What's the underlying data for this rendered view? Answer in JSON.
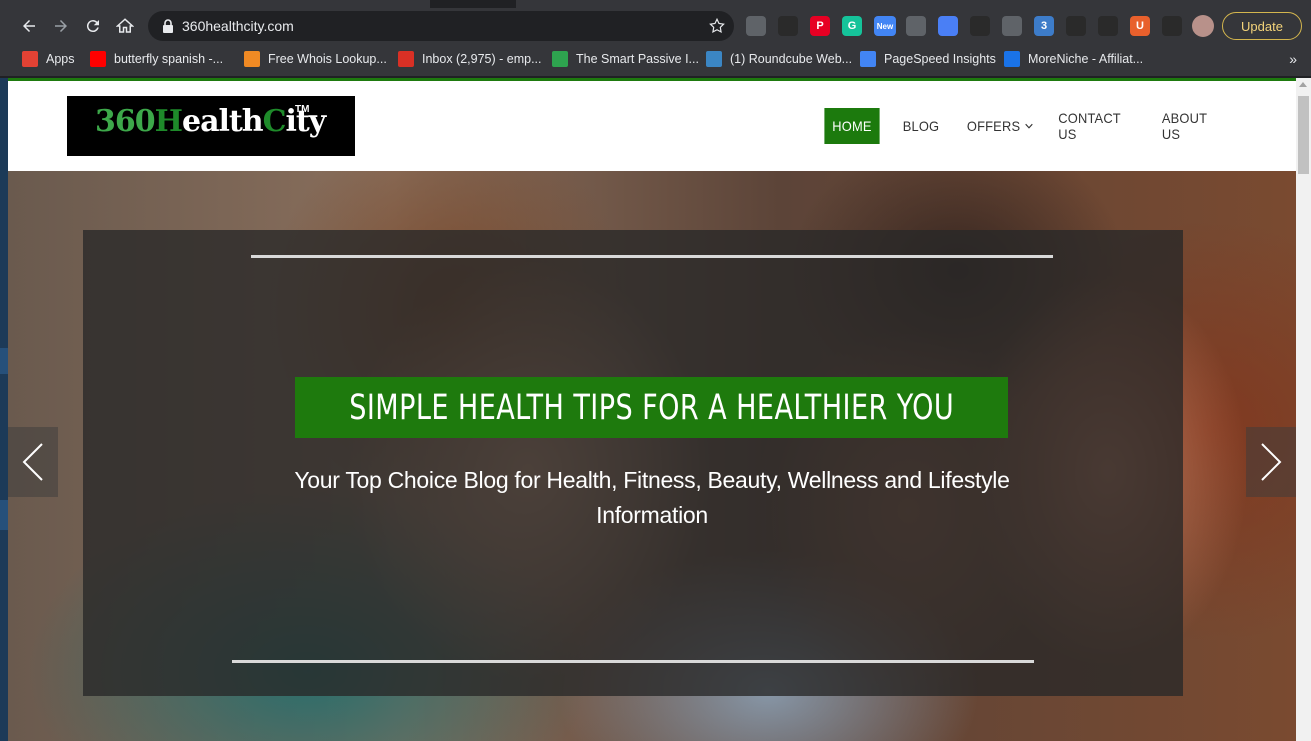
{
  "browser": {
    "url": "360healthcity.com",
    "update_label": "Update",
    "extensions": [
      {
        "name": "download-icon",
        "label": "",
        "color": "#5f6368"
      },
      {
        "name": "pencil-ext-icon",
        "label": "",
        "color": "#2a2a2a"
      },
      {
        "name": "pinterest-icon",
        "label": "P",
        "color": "#e60023"
      },
      {
        "name": "grammarly-icon",
        "label": "G",
        "color": "#15c39a"
      },
      {
        "name": "new-ext-icon",
        "label": "New",
        "color": "#4285f4"
      },
      {
        "name": "half-circle-ext-icon",
        "label": "",
        "color": "#5f6368"
      },
      {
        "name": "checkbox-ext-icon",
        "label": "",
        "color": "#4a7ff5"
      },
      {
        "name": "checkmark-ext-icon",
        "label": "",
        "color": "#2a2a2a"
      },
      {
        "name": "diamond-ext-icon",
        "label": "",
        "color": "#5f6368"
      },
      {
        "name": "code-ext-icon",
        "label": "3",
        "color": "#3d7cc9"
      },
      {
        "name": "react-ext-icon",
        "label": "",
        "color": "#2a2a2a"
      },
      {
        "name": "target-ext-icon",
        "label": "",
        "color": "#2a2a2a"
      },
      {
        "name": "ublock-icon",
        "label": "U",
        "color": "#e8602c"
      },
      {
        "name": "puzzle-icon",
        "label": "",
        "color": "#2a2a2a"
      }
    ]
  },
  "bookmarks": [
    {
      "name": "bookmark-apps",
      "label": "Apps",
      "color": "#e34234"
    },
    {
      "name": "bookmark-butterfly-spanish",
      "label": "butterfly spanish -...",
      "color": "#ff0000"
    },
    {
      "name": "bookmark-whois",
      "label": "Free Whois Lookup...",
      "color": "#f08a24"
    },
    {
      "name": "bookmark-inbox",
      "label": "Inbox (2,975) - emp...",
      "color": "#d93025"
    },
    {
      "name": "bookmark-smart-passive",
      "label": "The Smart Passive I...",
      "color": "#2ea44f"
    },
    {
      "name": "bookmark-roundcube",
      "label": "(1) Roundcube Web...",
      "color": "#3b86c4"
    },
    {
      "name": "bookmark-pagespeed",
      "label": "PageSpeed Insights",
      "color": "#4285f4"
    },
    {
      "name": "bookmark-moreniche",
      "label": "MoreNiche - Affiliat...",
      "color": "#1a73e8"
    }
  ],
  "site": {
    "logo": {
      "part1": "360",
      "part2": "H",
      "part3": "ealth",
      "part4": "C",
      "part5": "ity",
      "tm": "TM"
    },
    "nav": [
      {
        "name": "nav-home",
        "label": "HOME",
        "active": true
      },
      {
        "name": "nav-blog",
        "label": "BLOG",
        "active": false
      },
      {
        "name": "nav-offers",
        "label": "OFFERS",
        "active": false
      },
      {
        "name": "nav-contact",
        "label": "CONTACT US",
        "active": false
      },
      {
        "name": "nav-about",
        "label": "ABOUT US",
        "active": false
      }
    ],
    "hero": {
      "headline": "SIMPLE HEALTH TIPS FOR A HEALTHIER YOU",
      "subtitle": "Your Top Choice Blog for Health, Fitness, Beauty, Wellness and Lifestyle Information"
    }
  },
  "colors": {
    "brand_green": "#1e7a0d",
    "chrome_dark": "#35363a"
  }
}
